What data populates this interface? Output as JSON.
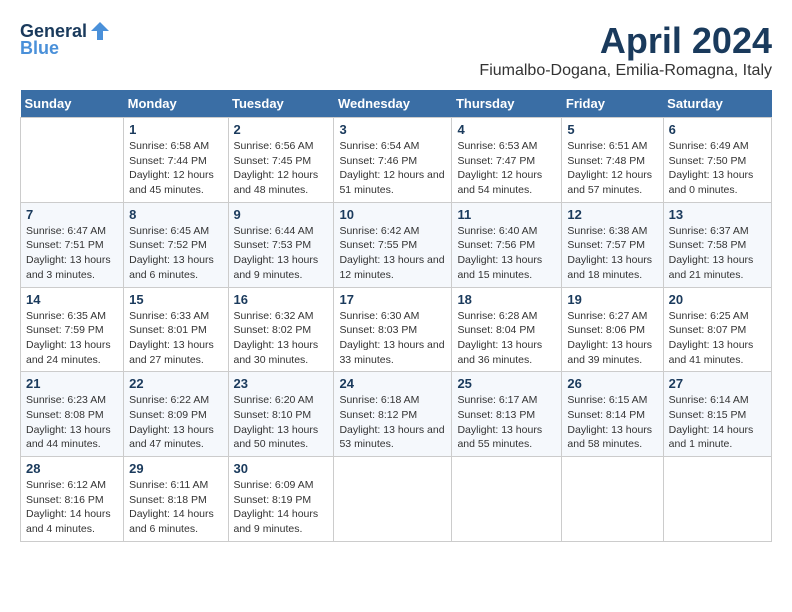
{
  "header": {
    "logo_line1": "General",
    "logo_line2": "Blue",
    "title": "April 2024",
    "subtitle": "Fiumalbo-Dogana, Emilia-Romagna, Italy"
  },
  "weekdays": [
    "Sunday",
    "Monday",
    "Tuesday",
    "Wednesday",
    "Thursday",
    "Friday",
    "Saturday"
  ],
  "weeks": [
    [
      {
        "day": "",
        "sunrise": "",
        "sunset": "",
        "daylight": ""
      },
      {
        "day": "1",
        "sunrise": "Sunrise: 6:58 AM",
        "sunset": "Sunset: 7:44 PM",
        "daylight": "Daylight: 12 hours and 45 minutes."
      },
      {
        "day": "2",
        "sunrise": "Sunrise: 6:56 AM",
        "sunset": "Sunset: 7:45 PM",
        "daylight": "Daylight: 12 hours and 48 minutes."
      },
      {
        "day": "3",
        "sunrise": "Sunrise: 6:54 AM",
        "sunset": "Sunset: 7:46 PM",
        "daylight": "Daylight: 12 hours and 51 minutes."
      },
      {
        "day": "4",
        "sunrise": "Sunrise: 6:53 AM",
        "sunset": "Sunset: 7:47 PM",
        "daylight": "Daylight: 12 hours and 54 minutes."
      },
      {
        "day": "5",
        "sunrise": "Sunrise: 6:51 AM",
        "sunset": "Sunset: 7:48 PM",
        "daylight": "Daylight: 12 hours and 57 minutes."
      },
      {
        "day": "6",
        "sunrise": "Sunrise: 6:49 AM",
        "sunset": "Sunset: 7:50 PM",
        "daylight": "Daylight: 13 hours and 0 minutes."
      }
    ],
    [
      {
        "day": "7",
        "sunrise": "Sunrise: 6:47 AM",
        "sunset": "Sunset: 7:51 PM",
        "daylight": "Daylight: 13 hours and 3 minutes."
      },
      {
        "day": "8",
        "sunrise": "Sunrise: 6:45 AM",
        "sunset": "Sunset: 7:52 PM",
        "daylight": "Daylight: 13 hours and 6 minutes."
      },
      {
        "day": "9",
        "sunrise": "Sunrise: 6:44 AM",
        "sunset": "Sunset: 7:53 PM",
        "daylight": "Daylight: 13 hours and 9 minutes."
      },
      {
        "day": "10",
        "sunrise": "Sunrise: 6:42 AM",
        "sunset": "Sunset: 7:55 PM",
        "daylight": "Daylight: 13 hours and 12 minutes."
      },
      {
        "day": "11",
        "sunrise": "Sunrise: 6:40 AM",
        "sunset": "Sunset: 7:56 PM",
        "daylight": "Daylight: 13 hours and 15 minutes."
      },
      {
        "day": "12",
        "sunrise": "Sunrise: 6:38 AM",
        "sunset": "Sunset: 7:57 PM",
        "daylight": "Daylight: 13 hours and 18 minutes."
      },
      {
        "day": "13",
        "sunrise": "Sunrise: 6:37 AM",
        "sunset": "Sunset: 7:58 PM",
        "daylight": "Daylight: 13 hours and 21 minutes."
      }
    ],
    [
      {
        "day": "14",
        "sunrise": "Sunrise: 6:35 AM",
        "sunset": "Sunset: 7:59 PM",
        "daylight": "Daylight: 13 hours and 24 minutes."
      },
      {
        "day": "15",
        "sunrise": "Sunrise: 6:33 AM",
        "sunset": "Sunset: 8:01 PM",
        "daylight": "Daylight: 13 hours and 27 minutes."
      },
      {
        "day": "16",
        "sunrise": "Sunrise: 6:32 AM",
        "sunset": "Sunset: 8:02 PM",
        "daylight": "Daylight: 13 hours and 30 minutes."
      },
      {
        "day": "17",
        "sunrise": "Sunrise: 6:30 AM",
        "sunset": "Sunset: 8:03 PM",
        "daylight": "Daylight: 13 hours and 33 minutes."
      },
      {
        "day": "18",
        "sunrise": "Sunrise: 6:28 AM",
        "sunset": "Sunset: 8:04 PM",
        "daylight": "Daylight: 13 hours and 36 minutes."
      },
      {
        "day": "19",
        "sunrise": "Sunrise: 6:27 AM",
        "sunset": "Sunset: 8:06 PM",
        "daylight": "Daylight: 13 hours and 39 minutes."
      },
      {
        "day": "20",
        "sunrise": "Sunrise: 6:25 AM",
        "sunset": "Sunset: 8:07 PM",
        "daylight": "Daylight: 13 hours and 41 minutes."
      }
    ],
    [
      {
        "day": "21",
        "sunrise": "Sunrise: 6:23 AM",
        "sunset": "Sunset: 8:08 PM",
        "daylight": "Daylight: 13 hours and 44 minutes."
      },
      {
        "day": "22",
        "sunrise": "Sunrise: 6:22 AM",
        "sunset": "Sunset: 8:09 PM",
        "daylight": "Daylight: 13 hours and 47 minutes."
      },
      {
        "day": "23",
        "sunrise": "Sunrise: 6:20 AM",
        "sunset": "Sunset: 8:10 PM",
        "daylight": "Daylight: 13 hours and 50 minutes."
      },
      {
        "day": "24",
        "sunrise": "Sunrise: 6:18 AM",
        "sunset": "Sunset: 8:12 PM",
        "daylight": "Daylight: 13 hours and 53 minutes."
      },
      {
        "day": "25",
        "sunrise": "Sunrise: 6:17 AM",
        "sunset": "Sunset: 8:13 PM",
        "daylight": "Daylight: 13 hours and 55 minutes."
      },
      {
        "day": "26",
        "sunrise": "Sunrise: 6:15 AM",
        "sunset": "Sunset: 8:14 PM",
        "daylight": "Daylight: 13 hours and 58 minutes."
      },
      {
        "day": "27",
        "sunrise": "Sunrise: 6:14 AM",
        "sunset": "Sunset: 8:15 PM",
        "daylight": "Daylight: 14 hours and 1 minute."
      }
    ],
    [
      {
        "day": "28",
        "sunrise": "Sunrise: 6:12 AM",
        "sunset": "Sunset: 8:16 PM",
        "daylight": "Daylight: 14 hours and 4 minutes."
      },
      {
        "day": "29",
        "sunrise": "Sunrise: 6:11 AM",
        "sunset": "Sunset: 8:18 PM",
        "daylight": "Daylight: 14 hours and 6 minutes."
      },
      {
        "day": "30",
        "sunrise": "Sunrise: 6:09 AM",
        "sunset": "Sunset: 8:19 PM",
        "daylight": "Daylight: 14 hours and 9 minutes."
      },
      {
        "day": "",
        "sunrise": "",
        "sunset": "",
        "daylight": ""
      },
      {
        "day": "",
        "sunrise": "",
        "sunset": "",
        "daylight": ""
      },
      {
        "day": "",
        "sunrise": "",
        "sunset": "",
        "daylight": ""
      },
      {
        "day": "",
        "sunrise": "",
        "sunset": "",
        "daylight": ""
      }
    ]
  ]
}
